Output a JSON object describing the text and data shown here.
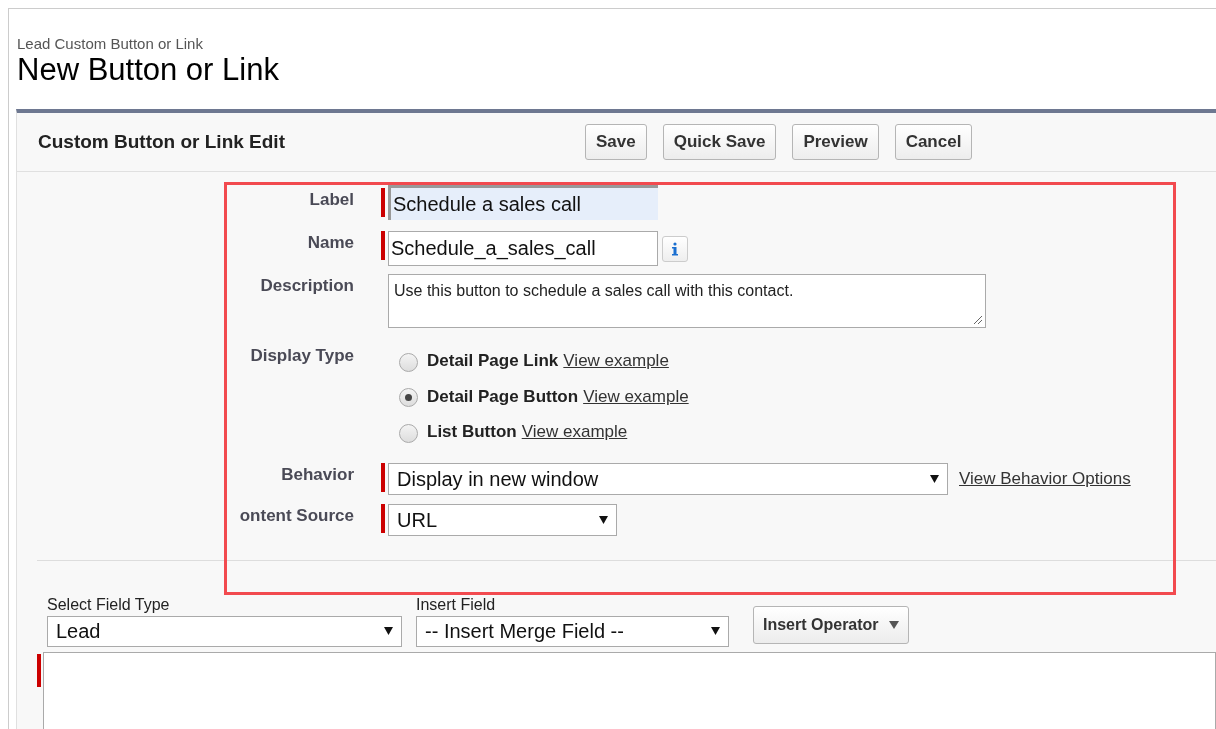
{
  "breadcrumb": "Lead Custom Button or Link",
  "title": "New Button or Link",
  "panel": {
    "title": "Custom Button or Link Edit",
    "buttons": [
      "Save",
      "Quick Save",
      "Preview",
      "Cancel"
    ]
  },
  "fields": [
    {
      "kind": "text",
      "label": "Label",
      "value": "Schedule a sales call",
      "required": true,
      "focused": true,
      "info": false
    },
    {
      "kind": "text",
      "label": "Name",
      "value": "Schedule_a_sales_call",
      "required": true,
      "focused": false,
      "info": true
    },
    {
      "kind": "textarea",
      "label": "Description",
      "value": "Use this button to schedule a sales call with this contact.",
      "required": false
    },
    {
      "kind": "radio",
      "label": "Display Type",
      "options": [
        {
          "label": "Detail Page Link",
          "link": "View example",
          "selected": false
        },
        {
          "label": "Detail Page Button",
          "link": "View example",
          "selected": true
        },
        {
          "label": "List Button",
          "link": "View example",
          "selected": false
        }
      ]
    },
    {
      "kind": "select",
      "label": "Behavior",
      "value": "Display in new window",
      "required": true,
      "wide": true,
      "link": "View Behavior Options"
    },
    {
      "kind": "select",
      "label": "ontent Source",
      "value": "URL",
      "required": true,
      "wide": false
    }
  ],
  "formula": {
    "field_type": {
      "label": "Select Field Type",
      "value": "Lead"
    },
    "insert_field": {
      "label": "Insert Field",
      "value": "-- Insert Merge Field --"
    },
    "operator_button": "Insert Operator",
    "required": true
  }
}
